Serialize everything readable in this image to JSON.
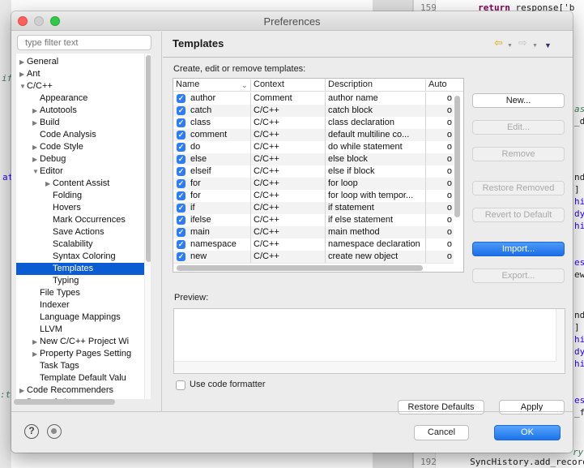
{
  "background_editor": {
    "top_line": {
      "number": "159",
      "keyword": "return",
      "code": " response['b"
    },
    "bottom_line": {
      "number": "192",
      "code": "SyncHistory.add_record"
    },
    "fragments": [
      "if",
      "at",
      ":te",
      "ase",
      "_db",
      "nd_",
      "]",
      "hir",
      "dy",
      "hir",
      "esu",
      "ew_",
      "nd_",
      "]",
      "hir",
      "dy",
      "hir",
      "esu",
      "_fr",
      "ry"
    ]
  },
  "window": {
    "title": "Preferences"
  },
  "sidebar": {
    "filter_placeholder": "type filter text",
    "items": [
      {
        "label": "General",
        "level": 0,
        "arrow": "collapsed"
      },
      {
        "label": "Ant",
        "level": 0,
        "arrow": "collapsed"
      },
      {
        "label": "C/C++",
        "level": 0,
        "arrow": "expanded"
      },
      {
        "label": "Appearance",
        "level": 1,
        "arrow": "none"
      },
      {
        "label": "Autotools",
        "level": 1,
        "arrow": "collapsed"
      },
      {
        "label": "Build",
        "level": 1,
        "arrow": "collapsed"
      },
      {
        "label": "Code Analysis",
        "level": 1,
        "arrow": "none"
      },
      {
        "label": "Code Style",
        "level": 1,
        "arrow": "collapsed"
      },
      {
        "label": "Debug",
        "level": 1,
        "arrow": "collapsed"
      },
      {
        "label": "Editor",
        "level": 1,
        "arrow": "expanded"
      },
      {
        "label": "Content Assist",
        "level": 2,
        "arrow": "collapsed"
      },
      {
        "label": "Folding",
        "level": 2,
        "arrow": "none"
      },
      {
        "label": "Hovers",
        "level": 2,
        "arrow": "none"
      },
      {
        "label": "Mark Occurrences",
        "level": 2,
        "arrow": "none"
      },
      {
        "label": "Save Actions",
        "level": 2,
        "arrow": "none"
      },
      {
        "label": "Scalability",
        "level": 2,
        "arrow": "none"
      },
      {
        "label": "Syntax Coloring",
        "level": 2,
        "arrow": "none"
      },
      {
        "label": "Templates",
        "level": 2,
        "arrow": "none",
        "selected": true
      },
      {
        "label": "Typing",
        "level": 2,
        "arrow": "none"
      },
      {
        "label": "File Types",
        "level": 1,
        "arrow": "none"
      },
      {
        "label": "Indexer",
        "level": 1,
        "arrow": "none"
      },
      {
        "label": "Language Mappings",
        "level": 1,
        "arrow": "none"
      },
      {
        "label": "LLVM",
        "level": 1,
        "arrow": "none"
      },
      {
        "label": "New C/C++ Project Wi",
        "level": 1,
        "arrow": "collapsed"
      },
      {
        "label": "Property Pages Setting",
        "level": 1,
        "arrow": "collapsed"
      },
      {
        "label": "Task Tags",
        "level": 1,
        "arrow": "none"
      },
      {
        "label": "Template Default Valu",
        "level": 1,
        "arrow": "none"
      },
      {
        "label": "Code Recommenders",
        "level": 0,
        "arrow": "collapsed"
      },
      {
        "label": "Dynamic Languages",
        "level": 0,
        "arrow": "collapsed"
      }
    ]
  },
  "main": {
    "title": "Templates",
    "nav": {
      "back_icon": "back-arrow-icon",
      "forward_icon": "forward-arrow-icon",
      "menu_icon": "view-menu-icon"
    },
    "description": "Create, edit or remove templates:",
    "table": {
      "columns": [
        "Name",
        "Context",
        "Description",
        "Auto"
      ],
      "rows": [
        {
          "checked": true,
          "name": "author",
          "context": "Comment",
          "description": "author name",
          "auto": "o"
        },
        {
          "checked": true,
          "name": "catch",
          "context": "C/C++",
          "description": "catch block",
          "auto": "o"
        },
        {
          "checked": true,
          "name": "class",
          "context": "C/C++",
          "description": "class declaration",
          "auto": "o"
        },
        {
          "checked": true,
          "name": "comment",
          "context": "C/C++",
          "description": "default multiline co...",
          "auto": "o"
        },
        {
          "checked": true,
          "name": "do",
          "context": "C/C++",
          "description": "do while statement",
          "auto": "o"
        },
        {
          "checked": true,
          "name": "else",
          "context": "C/C++",
          "description": "else block",
          "auto": "o"
        },
        {
          "checked": true,
          "name": "elseif",
          "context": "C/C++",
          "description": "else if block",
          "auto": "o"
        },
        {
          "checked": true,
          "name": "for",
          "context": "C/C++",
          "description": "for loop",
          "auto": "o"
        },
        {
          "checked": true,
          "name": "for",
          "context": "C/C++",
          "description": "for loop with tempor...",
          "auto": "o"
        },
        {
          "checked": true,
          "name": "if",
          "context": "C/C++",
          "description": "if statement",
          "auto": "o"
        },
        {
          "checked": true,
          "name": "ifelse",
          "context": "C/C++",
          "description": "if else statement",
          "auto": "o"
        },
        {
          "checked": true,
          "name": "main",
          "context": "C/C++",
          "description": "main method",
          "auto": "o"
        },
        {
          "checked": true,
          "name": "namespace",
          "context": "C/C++",
          "description": "namespace declaration",
          "auto": "o"
        },
        {
          "checked": true,
          "name": "new",
          "context": "C/C++",
          "description": "create new object",
          "auto": "o"
        }
      ]
    },
    "buttons": {
      "new": "New...",
      "edit": "Edit...",
      "remove": "Remove",
      "restore_removed": "Restore Removed",
      "revert_to_default": "Revert to Default",
      "import": "Import...",
      "export": "Export..."
    },
    "preview_label": "Preview:",
    "use_code_formatter": {
      "label": "Use code formatter",
      "checked": false
    },
    "restore_defaults": "Restore Defaults",
    "apply": "Apply"
  },
  "footer": {
    "cancel": "Cancel",
    "ok": "OK"
  },
  "colors": {
    "accent": "#0b5bd3",
    "primary_button": "#1a73ea",
    "checkbox": "#2e7cf6"
  }
}
